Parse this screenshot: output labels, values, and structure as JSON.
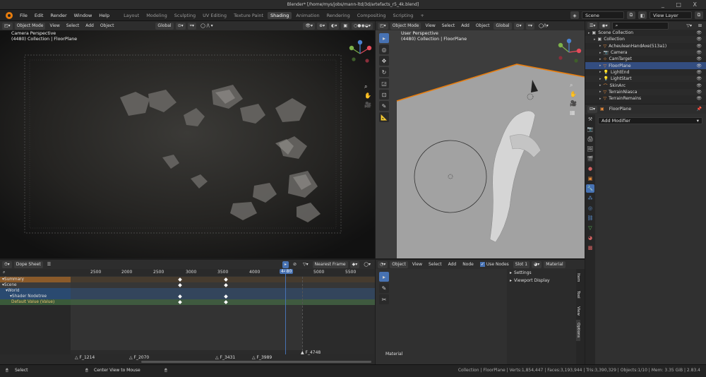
{
  "app": {
    "window_title": "Blender* [/home/mys/jobs/mann-ltd/3d/artefacts_r5_4k.blend]",
    "window_controls": "_ □ X"
  },
  "menubar": {
    "menus": [
      "File",
      "Edit",
      "Render",
      "Window",
      "Help"
    ],
    "workspaces": [
      "Layout",
      "Modeling",
      "Sculpting",
      "UV Editing",
      "Texture Paint",
      "Shading",
      "Animation",
      "Rendering",
      "Compositing",
      "Scripting",
      "+"
    ],
    "active_workspace": "Shading",
    "scene": "Scene",
    "view_layer": "View Layer"
  },
  "camera_viewport": {
    "mode": "Object Mode",
    "menus": [
      "View",
      "Select",
      "Add",
      "Object"
    ],
    "transform": "Global",
    "overlay_title": "Camera Perspective",
    "overlay_sub": "(4480) Collection | FloorPlane"
  },
  "user_viewport": {
    "mode": "Object Mode",
    "menus": [
      "View",
      "Select",
      "Add",
      "Object"
    ],
    "transform": "Global",
    "overlay_title": "User Perspective",
    "overlay_sub": "(4480) Collection | FloorPlane"
  },
  "outliner": {
    "search_placeholder": "",
    "rows": [
      {
        "label": "Scene Collection",
        "icon": "collection",
        "indent": 0
      },
      {
        "label": "Collection",
        "icon": "collection",
        "indent": 1
      },
      {
        "label": "AcheuleanHandAxe(513a1)",
        "icon": "mesh",
        "indent": 2
      },
      {
        "label": "Camera",
        "icon": "camera",
        "indent": 2
      },
      {
        "label": "CamTarget",
        "icon": "empty",
        "indent": 2
      },
      {
        "label": "FloorPlane",
        "icon": "mesh",
        "indent": 2,
        "selected": true
      },
      {
        "label": "LightEnd",
        "icon": "light",
        "indent": 2
      },
      {
        "label": "LightStart",
        "icon": "light",
        "indent": 2
      },
      {
        "label": "SkinArc",
        "icon": "curve",
        "indent": 2
      },
      {
        "label": "TerrainNiasca",
        "icon": "mesh",
        "indent": 2
      },
      {
        "label": "TerrainRemains",
        "icon": "mesh",
        "indent": 2
      }
    ]
  },
  "properties": {
    "object_name": "FloorPlane",
    "add_modifier": "Add Modifier"
  },
  "dope_sheet": {
    "mode": "Dope Sheet",
    "snap": "Nearest Frame",
    "ruler": [
      "2500",
      "2000",
      "2500",
      "3000",
      "3500",
      "4000",
      "4480",
      "5000",
      "5500"
    ],
    "current_frame": "4480",
    "channels": [
      {
        "label": "Summary",
        "kind": "summary"
      },
      {
        "label": "Scene",
        "kind": "scene"
      },
      {
        "label": "World",
        "kind": "world"
      },
      {
        "label": "Shader Nodetree",
        "kind": "nodetree"
      },
      {
        "label": "Default Value (Value)",
        "kind": "fcurve"
      }
    ],
    "markers": [
      "F_1214",
      "F_2070",
      "F_3431",
      "F_3989",
      "F_4748"
    ]
  },
  "node_editor": {
    "type": "Object",
    "menus": [
      "View",
      "Select",
      "Add",
      "Node"
    ],
    "use_nodes": "Use Nodes",
    "slot": "Slot 1",
    "material": "Material",
    "panels": [
      "Settings",
      "Viewport Display"
    ],
    "side_tabs": [
      "Item",
      "Tool",
      "View",
      "Options"
    ],
    "footer_label": "Material"
  },
  "status": {
    "left": "Select",
    "middle": "Center View to Mouse",
    "right": "Collection | FloorPlane | Verts:1,854,447 | Faces:3,193,944 | Tris:3,390,329 | Objects:1/10 | Mem: 3.35 GiB | 2.83.4"
  },
  "colors": {
    "accent": "#4772b3",
    "orange": "#e87d0d",
    "selected_row": "#334d80"
  }
}
